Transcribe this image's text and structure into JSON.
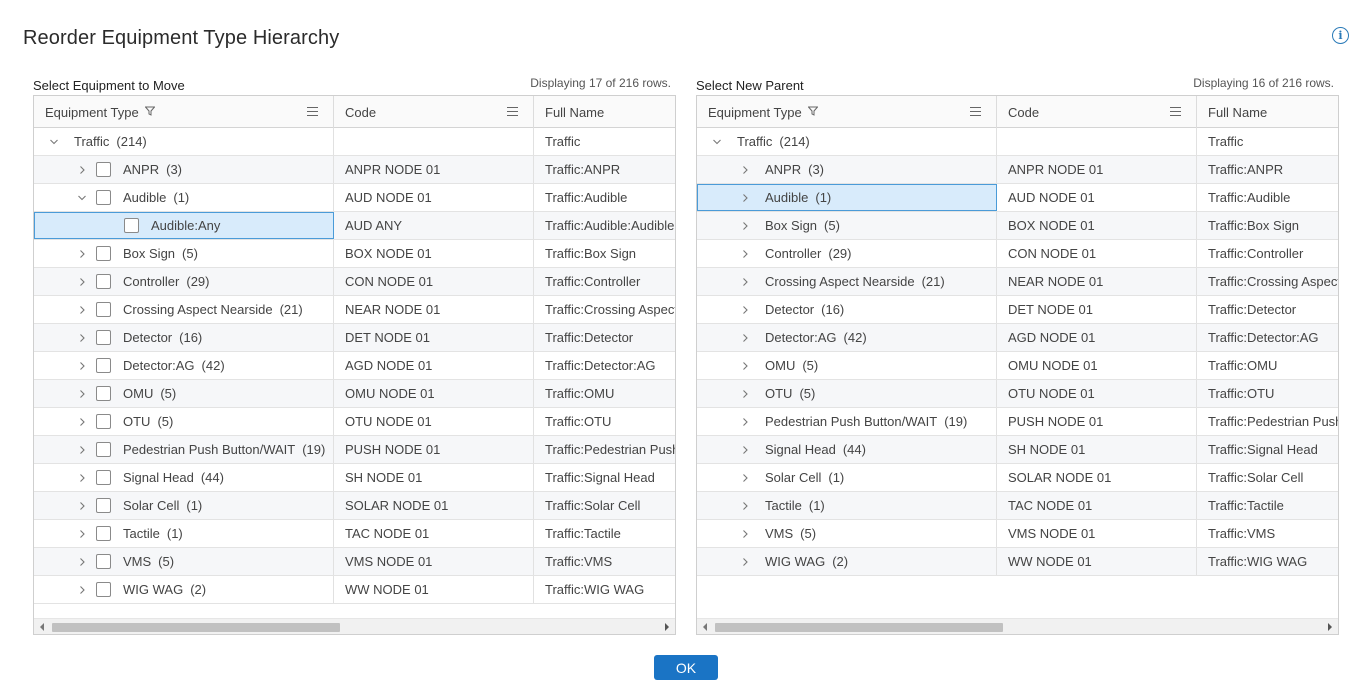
{
  "dialog": {
    "title": "Reorder Equipment Type Hierarchy",
    "ok_label": "OK",
    "info_icon": "info-icon"
  },
  "left": {
    "label": "Select Equipment to Move",
    "count": "Displaying 17 of 216 rows.",
    "headers": {
      "type": "Equipment Type",
      "code": "Code",
      "full": "Full Name"
    },
    "rows": [
      {
        "indent": 0,
        "chev": "down",
        "check": false,
        "name": "Traffic",
        "count": "(214)",
        "code": "",
        "full": "Traffic",
        "sel": false
      },
      {
        "indent": 1,
        "chev": "right",
        "check": true,
        "name": "ANPR",
        "count": "(3)",
        "code": "ANPR NODE 01",
        "full": "Traffic:ANPR",
        "sel": false
      },
      {
        "indent": 1,
        "chev": "down",
        "check": true,
        "name": "Audible",
        "count": "(1)",
        "code": "AUD NODE 01",
        "full": "Traffic:Audible",
        "sel": false
      },
      {
        "indent": 2,
        "chev": "none",
        "check": true,
        "name": "Audible:Any",
        "count": "",
        "code": "AUD ANY",
        "full": "Traffic:Audible:Audible:Any",
        "sel": true
      },
      {
        "indent": 1,
        "chev": "right",
        "check": true,
        "name": "Box Sign",
        "count": "(5)",
        "code": "BOX NODE 01",
        "full": "Traffic:Box Sign",
        "sel": false
      },
      {
        "indent": 1,
        "chev": "right",
        "check": true,
        "name": "Controller",
        "count": "(29)",
        "code": "CON NODE 01",
        "full": "Traffic:Controller",
        "sel": false
      },
      {
        "indent": 1,
        "chev": "right",
        "check": true,
        "name": "Crossing Aspect Nearside",
        "count": "(21)",
        "code": "NEAR NODE 01",
        "full": "Traffic:Crossing Aspect Nearside",
        "sel": false
      },
      {
        "indent": 1,
        "chev": "right",
        "check": true,
        "name": "Detector",
        "count": "(16)",
        "code": "DET NODE 01",
        "full": "Traffic:Detector",
        "sel": false
      },
      {
        "indent": 1,
        "chev": "right",
        "check": true,
        "name": "Detector:AG",
        "count": "(42)",
        "code": "AGD NODE 01",
        "full": "Traffic:Detector:AG",
        "sel": false
      },
      {
        "indent": 1,
        "chev": "right",
        "check": true,
        "name": "OMU",
        "count": "(5)",
        "code": "OMU NODE 01",
        "full": "Traffic:OMU",
        "sel": false
      },
      {
        "indent": 1,
        "chev": "right",
        "check": true,
        "name": "OTU",
        "count": "(5)",
        "code": "OTU NODE 01",
        "full": "Traffic:OTU",
        "sel": false
      },
      {
        "indent": 1,
        "chev": "right",
        "check": true,
        "name": "Pedestrian Push Button/WAIT",
        "count": "(19)",
        "code": "PUSH NODE 01",
        "full": "Traffic:Pedestrian Push Button/WAIT",
        "sel": false
      },
      {
        "indent": 1,
        "chev": "right",
        "check": true,
        "name": "Signal Head",
        "count": "(44)",
        "code": "SH NODE 01",
        "full": "Traffic:Signal Head",
        "sel": false
      },
      {
        "indent": 1,
        "chev": "right",
        "check": true,
        "name": "Solar Cell",
        "count": "(1)",
        "code": "SOLAR NODE 01",
        "full": "Traffic:Solar Cell",
        "sel": false
      },
      {
        "indent": 1,
        "chev": "right",
        "check": true,
        "name": "Tactile",
        "count": "(1)",
        "code": "TAC NODE 01",
        "full": "Traffic:Tactile",
        "sel": false
      },
      {
        "indent": 1,
        "chev": "right",
        "check": true,
        "name": "VMS",
        "count": "(5)",
        "code": "VMS NODE 01",
        "full": "Traffic:VMS",
        "sel": false
      },
      {
        "indent": 1,
        "chev": "right",
        "check": true,
        "name": "WIG WAG",
        "count": "(2)",
        "code": "WW NODE 01",
        "full": "Traffic:WIG WAG",
        "sel": false
      }
    ]
  },
  "right": {
    "label": "Select New Parent",
    "count": "Displaying 16 of 216 rows.",
    "headers": {
      "type": "Equipment Type",
      "code": "Code",
      "full": "Full Name"
    },
    "rows": [
      {
        "indent": 0,
        "chev": "down",
        "check": false,
        "name": "Traffic",
        "count": "(214)",
        "code": "",
        "full": "Traffic",
        "sel": false
      },
      {
        "indent": 1,
        "chev": "right",
        "check": false,
        "name": "ANPR",
        "count": "(3)",
        "code": "ANPR NODE 01",
        "full": "Traffic:ANPR",
        "sel": false
      },
      {
        "indent": 1,
        "chev": "right",
        "check": false,
        "name": "Audible",
        "count": "(1)",
        "code": "AUD NODE 01",
        "full": "Traffic:Audible",
        "sel": true
      },
      {
        "indent": 1,
        "chev": "right",
        "check": false,
        "name": "Box Sign",
        "count": "(5)",
        "code": "BOX NODE 01",
        "full": "Traffic:Box Sign",
        "sel": false
      },
      {
        "indent": 1,
        "chev": "right",
        "check": false,
        "name": "Controller",
        "count": "(29)",
        "code": "CON NODE 01",
        "full": "Traffic:Controller",
        "sel": false
      },
      {
        "indent": 1,
        "chev": "right",
        "check": false,
        "name": "Crossing Aspect Nearside",
        "count": "(21)",
        "code": "NEAR NODE 01",
        "full": "Traffic:Crossing Aspect Nearside",
        "sel": false
      },
      {
        "indent": 1,
        "chev": "right",
        "check": false,
        "name": "Detector",
        "count": "(16)",
        "code": "DET NODE 01",
        "full": "Traffic:Detector",
        "sel": false
      },
      {
        "indent": 1,
        "chev": "right",
        "check": false,
        "name": "Detector:AG",
        "count": "(42)",
        "code": "AGD NODE 01",
        "full": "Traffic:Detector:AG",
        "sel": false
      },
      {
        "indent": 1,
        "chev": "right",
        "check": false,
        "name": "OMU",
        "count": "(5)",
        "code": "OMU NODE 01",
        "full": "Traffic:OMU",
        "sel": false
      },
      {
        "indent": 1,
        "chev": "right",
        "check": false,
        "name": "OTU",
        "count": "(5)",
        "code": "OTU NODE 01",
        "full": "Traffic:OTU",
        "sel": false
      },
      {
        "indent": 1,
        "chev": "right",
        "check": false,
        "name": "Pedestrian Push Button/WAIT",
        "count": "(19)",
        "code": "PUSH NODE 01",
        "full": "Traffic:Pedestrian Push Button/WAIT",
        "sel": false
      },
      {
        "indent": 1,
        "chev": "right",
        "check": false,
        "name": "Signal Head",
        "count": "(44)",
        "code": "SH NODE 01",
        "full": "Traffic:Signal Head",
        "sel": false
      },
      {
        "indent": 1,
        "chev": "right",
        "check": false,
        "name": "Solar Cell",
        "count": "(1)",
        "code": "SOLAR NODE 01",
        "full": "Traffic:Solar Cell",
        "sel": false
      },
      {
        "indent": 1,
        "chev": "right",
        "check": false,
        "name": "Tactile",
        "count": "(1)",
        "code": "TAC NODE 01",
        "full": "Traffic:Tactile",
        "sel": false
      },
      {
        "indent": 1,
        "chev": "right",
        "check": false,
        "name": "VMS",
        "count": "(5)",
        "code": "VMS NODE 01",
        "full": "Traffic:VMS",
        "sel": false
      },
      {
        "indent": 1,
        "chev": "right",
        "check": false,
        "name": "WIG WAG",
        "count": "(2)",
        "code": "WW NODE 01",
        "full": "Traffic:WIG WAG",
        "sel": false
      }
    ]
  }
}
